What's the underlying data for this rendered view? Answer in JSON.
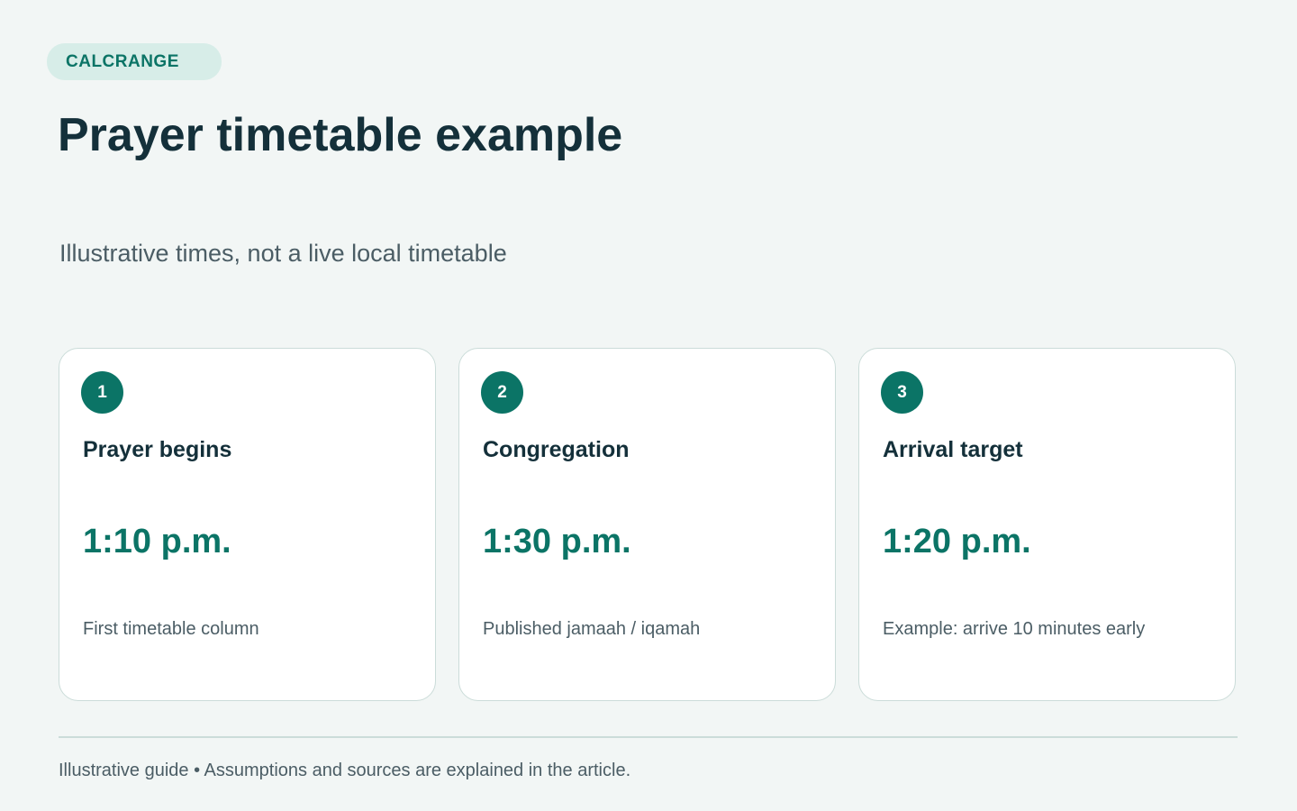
{
  "badge": {
    "label": "CALCRANGE"
  },
  "header": {
    "title": "Prayer timetable example",
    "subtitle": "Illustrative times, not a live local timetable"
  },
  "cards": [
    {
      "number": "1",
      "title": "Prayer begins",
      "time": "1:10 p.m.",
      "note": "First timetable column"
    },
    {
      "number": "2",
      "title": "Congregation",
      "time": "1:30 p.m.",
      "note": "Published jamaah / iqamah"
    },
    {
      "number": "3",
      "title": "Arrival target",
      "time": "1:20 p.m.",
      "note": "Example: arrive 10 minutes early"
    }
  ],
  "footer": {
    "text": "Illustrative guide • Assumptions and sources are explained in the article."
  },
  "colors": {
    "accent": "#0b7466",
    "badge_bg": "#d7ede8",
    "heading": "#14303a",
    "muted": "#4b5d65",
    "background": "#f2f6f5",
    "border": "#cbdcd9"
  }
}
